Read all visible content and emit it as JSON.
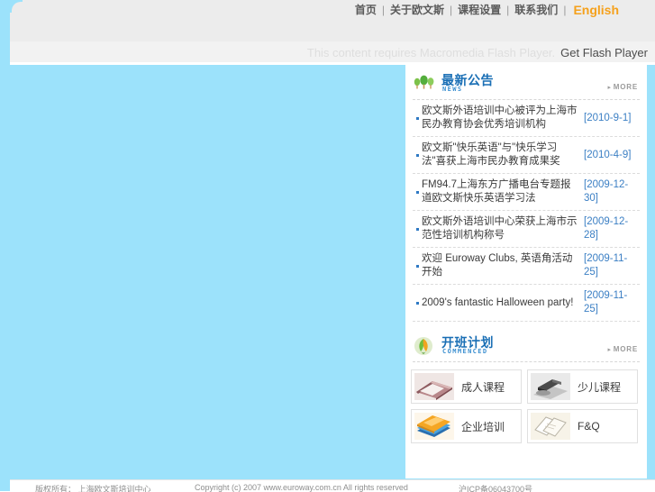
{
  "topnav": {
    "items": [
      {
        "label": "首页",
        "name": "home"
      },
      {
        "label": "关于欧文斯",
        "name": "about"
      },
      {
        "label": "课程设置",
        "name": "courses"
      },
      {
        "label": "联系我们",
        "name": "contact"
      },
      {
        "label": "English",
        "name": "english"
      }
    ],
    "separator": "|"
  },
  "flash": {
    "message": "This content requires Macromedia Flash Player.",
    "link_label": "Get Flash Player"
  },
  "news": {
    "title": "最新公告",
    "subtitle": "NEWS",
    "more_label": "MORE",
    "more_arrow": "▸",
    "icon": "three-trees-icon",
    "items": [
      {
        "title": "欧文斯外语培训中心被评为上海市民办教育协会优秀培训机构",
        "date": "[2010-9-1]"
      },
      {
        "title": "欧文斯\"快乐英语\"与\"快乐学习法\"喜获上海市民办教育成果奖",
        "date": "[2010-4-9]"
      },
      {
        "title": "FM94.7上海东方广播电台专题报道欧文斯快乐英语学习法",
        "date": "[2009-12-30]"
      },
      {
        "title": "欧文斯外语培训中心荣获上海市示范性培训机构称号",
        "date": "[2009-12-28]"
      },
      {
        "title": "欢迎 Euroway Clubs, 英语角活动开始",
        "date": "[2009-11-25]"
      },
      {
        "title": "2009's fantastic Halloween party!",
        "date": "[2009-11-25]"
      }
    ]
  },
  "commenced": {
    "title": "开班计划",
    "subtitle": "COMMENCED",
    "more_label": "MORE",
    "more_arrow": "▸",
    "icon": "leaf-icon",
    "cards": [
      {
        "label": "成人课程",
        "thumb": "book-photo"
      },
      {
        "label": "少儿课程",
        "thumb": "stapler-photo"
      },
      {
        "label": "企业培训",
        "thumb": "folders-photo"
      },
      {
        "label": "F&Q",
        "thumb": "notebooks-photo"
      }
    ]
  },
  "footer": {
    "left": "版权所有： 上海欧文斯培训中心",
    "center": "Copyright (c) 2007 www.euroway.com.cn All rights reserved",
    "right": "沪ICP备06043700号"
  },
  "colors": {
    "rail_blue": "#9ce2fb",
    "header_gray": "#ececec",
    "accent_orange": "#f5a11c",
    "title_blue": "#1a6fb5",
    "date_blue": "#3b7fc4"
  }
}
